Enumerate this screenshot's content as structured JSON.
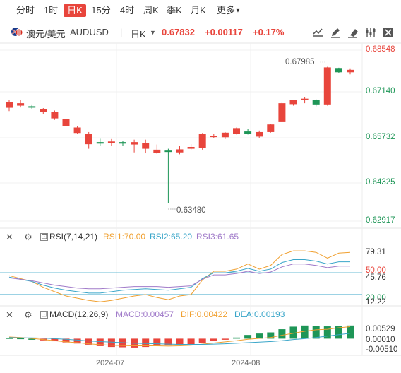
{
  "tabs": [
    {
      "label": "分时",
      "active": false
    },
    {
      "label": "1时",
      "active": false
    },
    {
      "label": "日K",
      "active": true
    },
    {
      "label": "15分",
      "active": false
    },
    {
      "label": "4时",
      "active": false
    },
    {
      "label": "周K",
      "active": false
    },
    {
      "label": "季K",
      "active": false
    },
    {
      "label": "月K",
      "active": false
    },
    {
      "label": "更多",
      "active": false,
      "has_dropdown": true
    }
  ],
  "info": {
    "pair": "澳元/美元",
    "symbol": "AUDUSD",
    "period": "日K",
    "price": "0.67832",
    "change": "+0.00117",
    "change_pct": "+0.17%"
  },
  "colors": {
    "up": "#e8453c",
    "down": "#1e9657",
    "accent": "#e8453c"
  },
  "main_axis": {
    "labels": [
      "0.68548",
      "0.67140",
      "0.65732",
      "0.64325",
      "0.62917"
    ],
    "ymin": 0.62917,
    "ymax": 0.68548
  },
  "annotations": {
    "high": "0.67985",
    "low": "0.63480"
  },
  "rsi": {
    "title": "RSI(7,14,21)",
    "rsi1": "RSI1:70.00",
    "rsi2": "RSI2:65.20",
    "rsi3": "RSI3:61.65",
    "axis_labels": [
      "79.31",
      "50.00",
      "45.76",
      "20.00",
      "12.22"
    ]
  },
  "macd": {
    "title": "MACD(12,26,9)",
    "macd": "MACD:0.00457",
    "dif": "DIF:0.00422",
    "dea": "DEA:0.00193",
    "axis_labels": [
      "0.00529",
      "0.00010",
      "-0.00510"
    ]
  },
  "x_labels": [
    "2024-07",
    "2024-08"
  ],
  "chart_data": [
    {
      "type": "candlestick",
      "title": "AUDUSD 日K",
      "ylim": [
        0.62917,
        0.68548
      ],
      "candles": [
        {
          "o": 0.6665,
          "c": 0.6683,
          "h": 0.669,
          "l": 0.6654
        },
        {
          "o": 0.6672,
          "c": 0.668,
          "h": 0.669,
          "l": 0.6666
        },
        {
          "o": 0.667,
          "c": 0.6666,
          "h": 0.6676,
          "l": 0.666
        },
        {
          "o": 0.6652,
          "c": 0.666,
          "h": 0.6664,
          "l": 0.6645
        },
        {
          "o": 0.663,
          "c": 0.6652,
          "h": 0.6656,
          "l": 0.6625
        },
        {
          "o": 0.6605,
          "c": 0.6628,
          "h": 0.6632,
          "l": 0.66
        },
        {
          "o": 0.6582,
          "c": 0.66,
          "h": 0.6605,
          "l": 0.6578
        },
        {
          "o": 0.6545,
          "c": 0.658,
          "h": 0.6585,
          "l": 0.653
        },
        {
          "o": 0.6552,
          "c": 0.6547,
          "h": 0.6563,
          "l": 0.654
        },
        {
          "o": 0.6548,
          "c": 0.6554,
          "h": 0.6562,
          "l": 0.654
        },
        {
          "o": 0.6552,
          "c": 0.6547,
          "h": 0.6556,
          "l": 0.654
        },
        {
          "o": 0.6544,
          "c": 0.6552,
          "h": 0.656,
          "l": 0.6518
        },
        {
          "o": 0.653,
          "c": 0.655,
          "h": 0.656,
          "l": 0.6515
        },
        {
          "o": 0.6516,
          "c": 0.6527,
          "h": 0.6544,
          "l": 0.6513
        },
        {
          "o": 0.6524,
          "c": 0.652,
          "h": 0.653,
          "l": 0.635
        },
        {
          "o": 0.6518,
          "c": 0.6528,
          "h": 0.654,
          "l": 0.6512
        },
        {
          "o": 0.653,
          "c": 0.6536,
          "h": 0.6545,
          "l": 0.6525
        },
        {
          "o": 0.6532,
          "c": 0.658,
          "h": 0.6582,
          "l": 0.6527
        },
        {
          "o": 0.657,
          "c": 0.6573,
          "h": 0.658,
          "l": 0.6565
        },
        {
          "o": 0.6568,
          "c": 0.6583,
          "h": 0.6585,
          "l": 0.6562
        },
        {
          "o": 0.658,
          "c": 0.6598,
          "h": 0.66,
          "l": 0.6577
        },
        {
          "o": 0.6587,
          "c": 0.658,
          "h": 0.6595,
          "l": 0.6577
        },
        {
          "o": 0.657,
          "c": 0.6585,
          "h": 0.659,
          "l": 0.6565
        },
        {
          "o": 0.6585,
          "c": 0.661,
          "h": 0.6612,
          "l": 0.6583
        },
        {
          "o": 0.662,
          "c": 0.668,
          "h": 0.6682,
          "l": 0.6618
        },
        {
          "o": 0.6677,
          "c": 0.669,
          "h": 0.6692,
          "l": 0.6672
        },
        {
          "o": 0.6692,
          "c": 0.6695,
          "h": 0.67,
          "l": 0.668
        },
        {
          "o": 0.669,
          "c": 0.6676,
          "h": 0.6693,
          "l": 0.667
        },
        {
          "o": 0.6676,
          "c": 0.6798,
          "h": 0.68,
          "l": 0.6672
        },
        {
          "o": 0.6796,
          "c": 0.6782,
          "h": 0.6797,
          "l": 0.6778
        },
        {
          "o": 0.6782,
          "c": 0.679,
          "h": 0.6795,
          "l": 0.6775
        }
      ]
    },
    {
      "type": "line",
      "title": "RSI(7,14,21)",
      "series": [
        {
          "name": "RSI1",
          "values": [
            46,
            42,
            38,
            30,
            24,
            18,
            15,
            12,
            10,
            12,
            15,
            18,
            20,
            16,
            13,
            18,
            20,
            40,
            52,
            52,
            55,
            62,
            55,
            60,
            75,
            80,
            80,
            78,
            70,
            77,
            78
          ]
        },
        {
          "name": "RSI2",
          "values": [
            44,
            41,
            38,
            33,
            29,
            26,
            24,
            22,
            22,
            24,
            26,
            27,
            28,
            27,
            26,
            28,
            30,
            42,
            50,
            50,
            52,
            56,
            52,
            55,
            64,
            68,
            68,
            66,
            62,
            65,
            65
          ]
        },
        {
          "name": "RSI3",
          "values": [
            43,
            41,
            39,
            36,
            33,
            31,
            29,
            28,
            28,
            29,
            30,
            31,
            31,
            31,
            30,
            31,
            32,
            41,
            47,
            47,
            49,
            52,
            49,
            51,
            58,
            62,
            62,
            60,
            57,
            59,
            59
          ]
        }
      ],
      "ylim": [
        12.22,
        85
      ]
    },
    {
      "type": "bar",
      "title": "MACD(12,26,9)",
      "values": [
        0.0003,
        0.0002,
        0.0,
        -0.0006,
        -0.0009,
        -0.0013,
        -0.0017,
        -0.0021,
        -0.0026,
        -0.0029,
        -0.003,
        -0.0031,
        -0.0029,
        -0.0026,
        -0.0024,
        -0.0022,
        -0.0019,
        -0.0015,
        -0.0008,
        -0.0002,
        0.0004,
        0.0013,
        0.0018,
        0.0022,
        0.0033,
        0.0042,
        0.0046,
        0.0045,
        0.0043,
        0.0045,
        0.0046
      ],
      "series": [
        {
          "name": "DIF",
          "values": [
            0.0006,
            0.0004,
            0.0001,
            -0.0003,
            -0.0007,
            -0.0011,
            -0.0014,
            -0.0018,
            -0.0021,
            -0.0023,
            -0.0024,
            -0.0025,
            -0.0025,
            -0.0025,
            -0.0026,
            -0.0025,
            -0.0023,
            -0.0019,
            -0.0015,
            -0.0011,
            -0.0007,
            -0.0002,
            0.0001,
            0.0004,
            0.0012,
            0.0019,
            0.0026,
            0.0031,
            0.0033,
            0.0038,
            0.0042
          ]
        },
        {
          "name": "DEA",
          "values": [
            0.0004,
            0.0003,
            0.0003,
            0.0002,
            0.0,
            -0.0002,
            -0.0005,
            -0.0008,
            -0.001,
            -0.0012,
            -0.0014,
            -0.0016,
            -0.0017,
            -0.0018,
            -0.0019,
            -0.002,
            -0.002,
            -0.002,
            -0.0019,
            -0.0018,
            -0.0016,
            -0.0014,
            -0.0012,
            -0.001,
            -0.0007,
            -0.0003,
            0.0,
            0.0004,
            0.0009,
            0.0014,
            0.0019
          ]
        }
      ],
      "ylim": [
        -0.0051,
        0.0053
      ]
    }
  ]
}
